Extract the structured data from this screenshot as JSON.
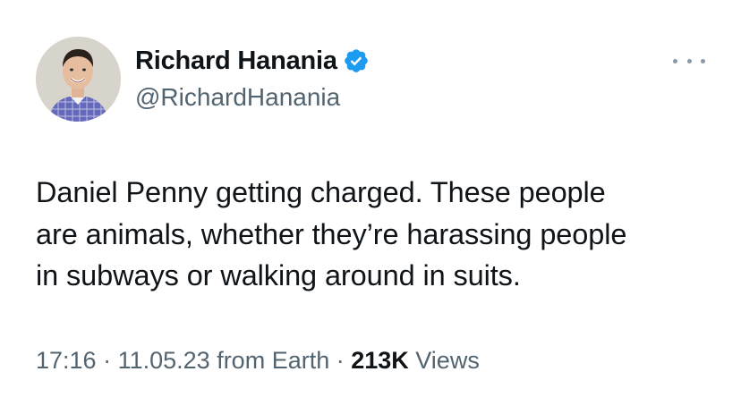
{
  "author": {
    "display_name": "Richard Hanania",
    "handle": "@RichardHanania",
    "verified_icon": "verified-badge-icon",
    "avatar": "profile-photo"
  },
  "menu": {
    "icon": "more-options-icon"
  },
  "tweet": {
    "text": "Daniel Penny getting charged. These people\nare animals, whether they’re harassing people\nin subways or walking around in suits."
  },
  "meta": {
    "time": "17:16",
    "sep1": " · ",
    "date": "11.05.23",
    "source": " from Earth",
    "sep2": " · ",
    "views_count": "213K",
    "views_label": " Views"
  },
  "colors": {
    "verified": "#1d9bf0",
    "secondary_text": "#536471",
    "primary_text": "#0f1419"
  }
}
